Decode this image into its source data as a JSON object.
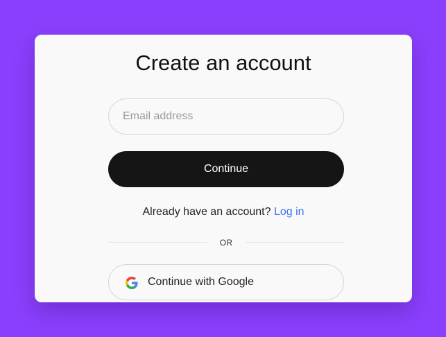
{
  "page": {
    "background_color": "#8a3ffc"
  },
  "card": {
    "title": "Create an account",
    "email": {
      "placeholder": "Email address",
      "value": ""
    },
    "continue_label": "Continue",
    "login_prompt": "Already have an account?",
    "login_link": "Log in",
    "divider_label": "OR",
    "google_label": "Continue with Google",
    "google_icon": "google-g-icon",
    "colors": {
      "primary_button": "#151515",
      "link": "#3b6ef5",
      "card_background": "#f9f9f9"
    }
  }
}
